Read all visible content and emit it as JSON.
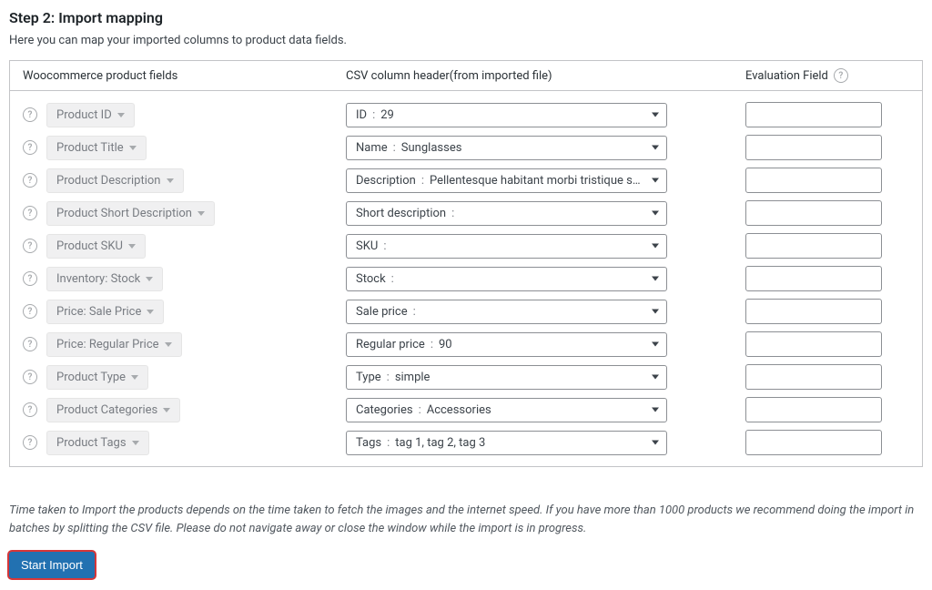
{
  "title": "Step 2: Import mapping",
  "subtitle": "Here you can map your imported columns to product data fields.",
  "headers": {
    "wc": "Woocommerce product fields",
    "csv": "CSV column header(from imported file)",
    "eval": "Evaluation Field"
  },
  "separator": ":",
  "rows": [
    {
      "wc": "Product ID",
      "csv_header": "ID",
      "csv_value": "29"
    },
    {
      "wc": "Product Title",
      "csv_header": "Name",
      "csv_value": "Sunglasses"
    },
    {
      "wc": "Product Description",
      "csv_header": "Description",
      "csv_value": "Pellentesque habitant morbi tristique senect"
    },
    {
      "wc": "Product Short Description",
      "csv_header": "Short description",
      "csv_value": ""
    },
    {
      "wc": "Product SKU",
      "csv_header": "SKU",
      "csv_value": ""
    },
    {
      "wc": "Inventory: Stock",
      "csv_header": "Stock",
      "csv_value": ""
    },
    {
      "wc": "Price: Sale Price",
      "csv_header": "Sale price",
      "csv_value": ""
    },
    {
      "wc": "Price: Regular Price",
      "csv_header": "Regular price",
      "csv_value": "90"
    },
    {
      "wc": "Product Type",
      "csv_header": "Type",
      "csv_value": "simple"
    },
    {
      "wc": "Product Categories",
      "csv_header": "Categories",
      "csv_value": "Accessories"
    },
    {
      "wc": "Product Tags",
      "csv_header": "Tags",
      "csv_value": "tag 1, tag 2, tag 3"
    }
  ],
  "note": "Time taken to Import the products depends on the time taken to fetch the images and the internet speed. If you have more than 1000 products we recommend doing the import in batches by splitting the CSV file. Please do not navigate away or close the window while the import is in progress.",
  "start_button": "Start Import"
}
